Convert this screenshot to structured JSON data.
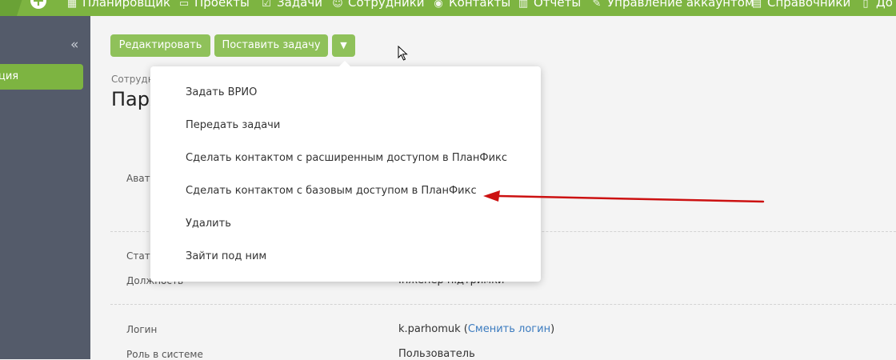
{
  "topnav": {
    "items": [
      {
        "label": "Планировщик",
        "icon": "calendar-grid-icon"
      },
      {
        "label": "Проекты",
        "icon": "folder-icon"
      },
      {
        "label": "Задачи",
        "icon": "checkbox-icon"
      },
      {
        "label": "Сотрудники",
        "icon": "people-icon"
      },
      {
        "label": "Контакты",
        "icon": "contact-icon"
      },
      {
        "label": "Отчеты",
        "icon": "bar-chart-icon"
      },
      {
        "label": "Управление аккаунтом",
        "icon": "wrench-icon"
      },
      {
        "label": "Справочники",
        "icon": "book-icon"
      },
      {
        "label": "До",
        "icon": "doc-icon"
      }
    ]
  },
  "sidebar": {
    "active_item": "ция"
  },
  "actions": {
    "edit_label": "Редактировать",
    "task_label": "Поставить задачу",
    "more_icon": "▼"
  },
  "header": {
    "crumb": "Сотрудн",
    "title": "Парх"
  },
  "fields": {
    "avatar_label": "Авата",
    "status_label": "Стату",
    "position_label": "Должность",
    "position_value": "Інженер підтримки",
    "login_label": "Логин",
    "login_value": "k.parhomuk",
    "login_change_link": "Сменить логин",
    "role_label": "Роль в системе",
    "role_value": "Пользователь"
  },
  "dropdown": {
    "items": [
      "Задать ВРИО",
      "Передать задачи",
      "Сделать контактом с расширенным доступом в ПланФикс",
      "Сделать контактом с базовым доступом в ПланФикс",
      "Удалить",
      "Зайти под ним"
    ]
  },
  "colors": {
    "accent": "#7db441",
    "sidebar": "#545b6a",
    "annotation": "#cc1111",
    "link": "#3b7bbf"
  }
}
